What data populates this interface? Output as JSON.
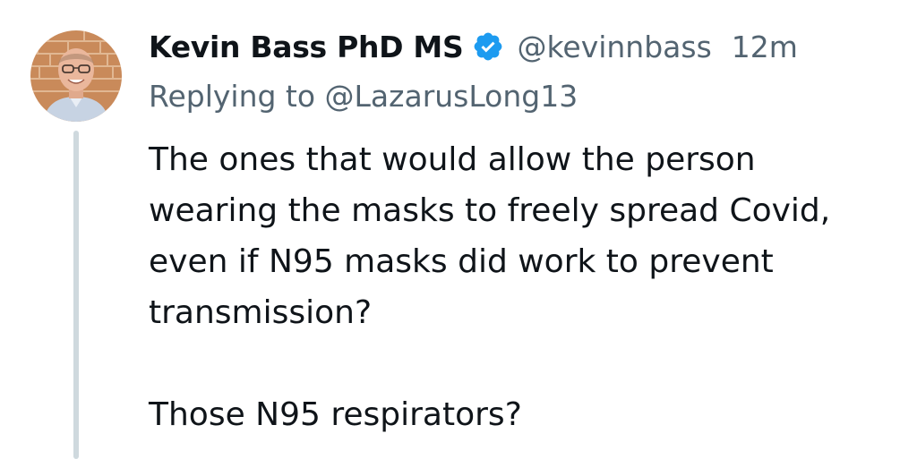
{
  "tweet": {
    "author_name": "Kevin Bass PhD MS",
    "verified_icon": "verified-badge-icon",
    "handle": "@kevinnbass",
    "time": "12m",
    "replying_prefix": "Replying to ",
    "replying_handle": "@LazarusLong13",
    "paragraph_1": "The ones that would allow the person\nwearing the masks to freely spread Covid,\neven if N95 masks did work to prevent\ntransmission?",
    "paragraph_2": "Those N95 respirators?"
  },
  "colors": {
    "text_primary": "#0f1419",
    "text_secondary": "#536471",
    "verified_blue": "#1d9bf0",
    "thread_line": "#cfd9de"
  }
}
